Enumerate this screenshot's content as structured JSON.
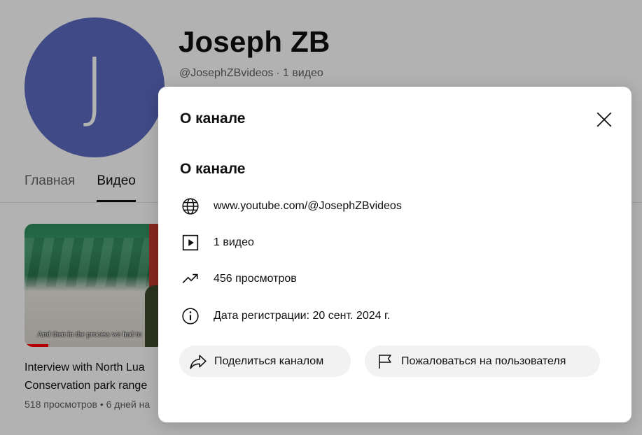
{
  "channel": {
    "avatar_letter": "J",
    "name": "Joseph ZB",
    "handle": "@JosephZBvideos",
    "separator": "·",
    "video_count": "1 видео",
    "avatar_color": "#5c6bc0"
  },
  "tabs": [
    {
      "label": "Главная",
      "active": false
    },
    {
      "label": "Видео",
      "active": true
    }
  ],
  "video": {
    "thumbnail_caption": "And then in the process we had to",
    "title_line1": "Interview with North Lua",
    "title_line2": "Conservation park range",
    "meta": "518 просмотров • 6 дней на"
  },
  "dialog": {
    "header_title": "О канале",
    "section_title": "О канале",
    "url": "www.youtube.com/@JosephZBvideos",
    "videos": "1 видео",
    "views": "456 просмотров",
    "joined": "Дата регистрации: 20 сент. 2024 г.",
    "share_label": "Поделиться каналом",
    "report_label": "Пожаловаться на пользователя",
    "icons": {
      "close": "close-icon",
      "url": "globe-icon",
      "videos": "video-play-icon",
      "views": "trending-icon",
      "joined": "info-icon",
      "share": "share-arrow-icon",
      "report": "flag-icon"
    }
  }
}
